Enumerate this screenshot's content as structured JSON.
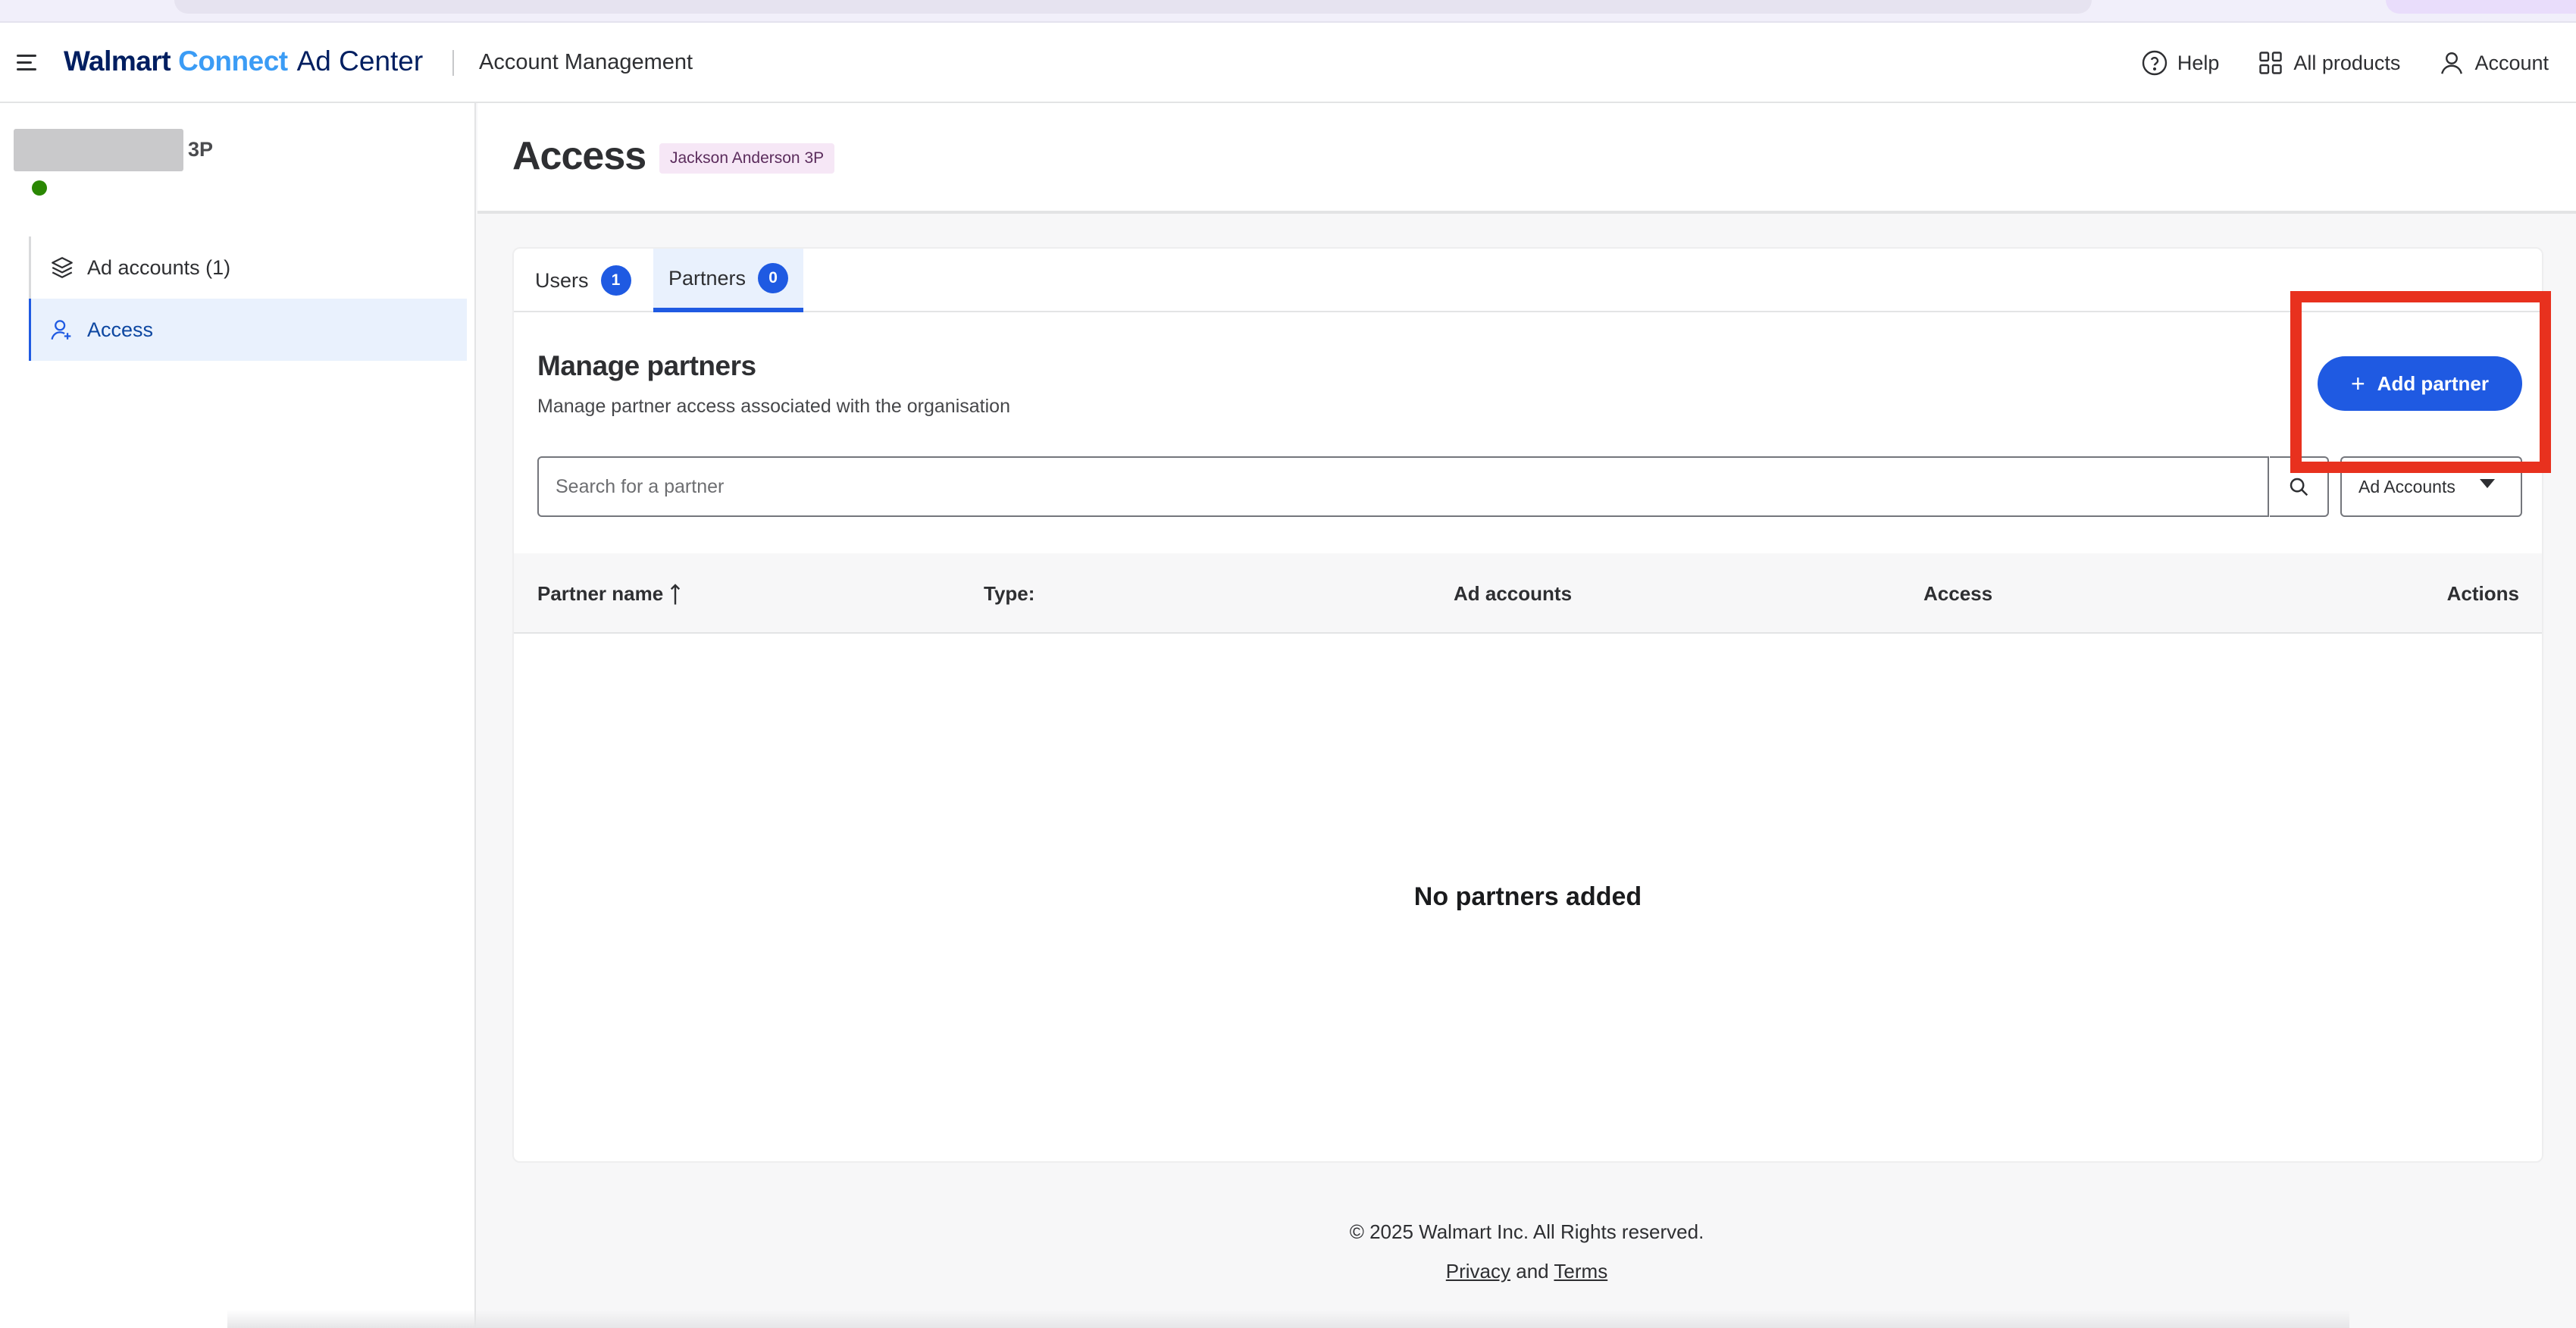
{
  "header": {
    "brand_walmart": "Walmart",
    "brand_connect": "Connect",
    "brand_adcenter": "Ad Center",
    "app_name": "Account Management",
    "help_label": "Help",
    "all_products_label": "All products",
    "account_label": "Account"
  },
  "sidebar": {
    "org_name_suffix": "3P",
    "items": [
      {
        "label": "Ad accounts (1)",
        "icon": "layers-icon",
        "active": false
      },
      {
        "label": "Access",
        "icon": "user-access-icon",
        "active": true
      }
    ]
  },
  "page": {
    "title": "Access",
    "org_tag": "Jackson Anderson 3P"
  },
  "tabs": [
    {
      "label": "Users",
      "count": "1",
      "active": false
    },
    {
      "label": "Partners",
      "count": "0",
      "active": true
    }
  ],
  "partners": {
    "title": "Manage partners",
    "subtitle": "Manage partner access associated with the organisation",
    "add_button": "Add partner",
    "search_placeholder": "Search for a partner",
    "filter_selected": "Ad Accounts",
    "columns": [
      "Partner name",
      "Type:",
      "Ad accounts",
      "Access",
      "Actions"
    ],
    "empty_message": "No partners added"
  },
  "footer": {
    "copyright": "© 2025 Walmart Inc. All Rights reserved.",
    "privacy": "Privacy",
    "and": "and",
    "terms": "Terms"
  },
  "colors": {
    "primary": "#1f5ae2",
    "brand_navy": "#001e60",
    "brand_blue": "#3b9cf5",
    "highlight": "#e8311e",
    "status_green": "#2a8703"
  }
}
